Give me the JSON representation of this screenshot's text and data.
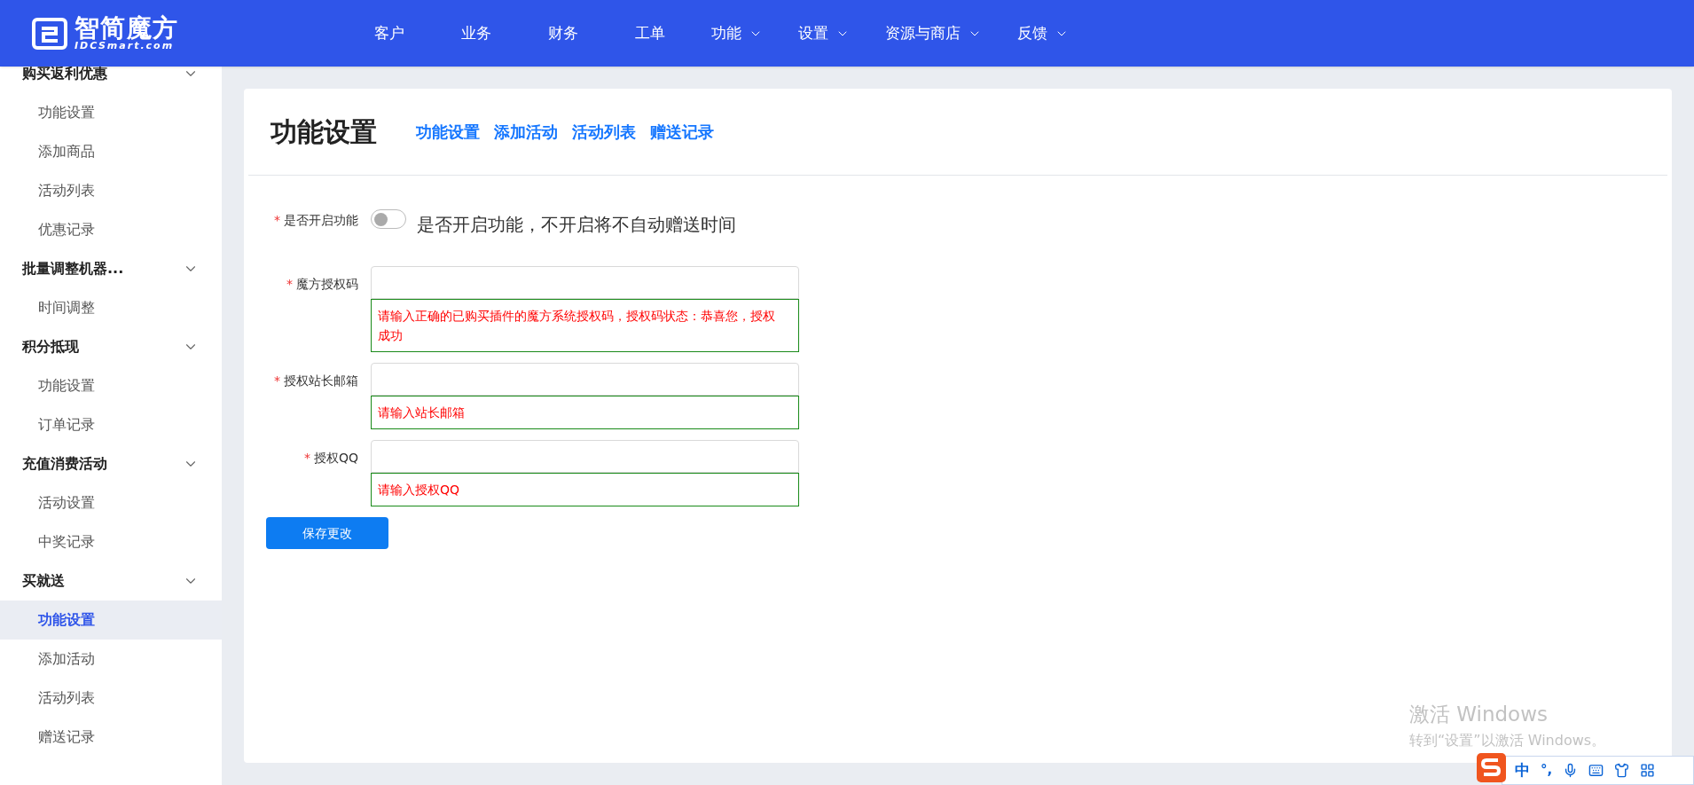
{
  "header": {
    "logo_text": "智简魔方",
    "logo_subtext": "IDCSmart.com",
    "nav": [
      {
        "label": "客户",
        "has_menu": false
      },
      {
        "label": "业务",
        "has_menu": false
      },
      {
        "label": "财务",
        "has_menu": false
      },
      {
        "label": "工单",
        "has_menu": false
      },
      {
        "label": "功能",
        "has_menu": true
      },
      {
        "label": "设置",
        "has_menu": true
      },
      {
        "label": "资源与商店",
        "has_menu": true
      },
      {
        "label": "反馈",
        "has_menu": true
      }
    ]
  },
  "sidebar": {
    "groups": [
      {
        "label": "购买返利优惠",
        "expanded": true,
        "children": [
          {
            "label": "功能设置",
            "selected": false
          },
          {
            "label": "添加商品",
            "selected": false
          },
          {
            "label": "活动列表",
            "selected": false
          },
          {
            "label": "优惠记录",
            "selected": false
          }
        ]
      },
      {
        "label": "批量调整机器...",
        "expanded": true,
        "children": [
          {
            "label": "时间调整",
            "selected": false
          }
        ]
      },
      {
        "label": "积分抵现",
        "expanded": true,
        "children": [
          {
            "label": "功能设置",
            "selected": false
          },
          {
            "label": "订单记录",
            "selected": false
          }
        ]
      },
      {
        "label": "充值消费活动",
        "expanded": true,
        "children": [
          {
            "label": "活动设置",
            "selected": false
          },
          {
            "label": "中奖记录",
            "selected": false
          }
        ]
      },
      {
        "label": "买就送",
        "expanded": true,
        "children": [
          {
            "label": "功能设置",
            "selected": true
          },
          {
            "label": "添加活动",
            "selected": false
          },
          {
            "label": "活动列表",
            "selected": false
          },
          {
            "label": "赠送记录",
            "selected": false
          }
        ]
      }
    ]
  },
  "page": {
    "title": "功能设置",
    "links": [
      "功能设置",
      "添加活动",
      "活动列表",
      "赠送记录"
    ],
    "form": [
      {
        "kind": "switch",
        "label": "是否开启功能",
        "required_mark": "*",
        "on": false,
        "description": "是否开启功能，不开启将不自动赠送时间"
      },
      {
        "kind": "input",
        "label": "魔方授权码",
        "required_mark": "*",
        "hint": "请输入正确的已购买插件的魔方系统授权码，授权码状态：恭喜您，授权成功"
      },
      {
        "kind": "input",
        "label": "授权站长邮箱",
        "required_mark": "*",
        "hint": "请输入站长邮箱"
      },
      {
        "kind": "input",
        "label": "授权QQ",
        "required_mark": "*",
        "hint": "请输入授权QQ"
      }
    ],
    "submit": "保存更改"
  },
  "os_overlay": {
    "activation_title": "激活 Windows",
    "activation_text": "转到“设置”以激活 Windows。",
    "ime_toolbar": [
      "中",
      "°,"
    ]
  }
}
